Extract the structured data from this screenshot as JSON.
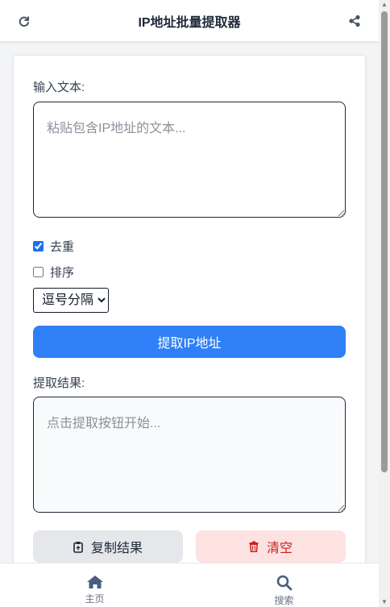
{
  "header": {
    "title": "IP地址批量提取器",
    "left_icon": "refresh-icon",
    "right_icon": "share-icon"
  },
  "form": {
    "input_label": "输入文本:",
    "input_placeholder": "粘贴包含IP地址的文本...",
    "input_value": "",
    "dedupe_label": "去重",
    "dedupe_checked": true,
    "sort_label": "排序",
    "sort_checked": false,
    "separator_selected": "逗号分隔",
    "extract_button": "提取IP地址",
    "result_label": "提取结果:",
    "result_placeholder": "点击提取按钮开始...",
    "copy_button": "复制结果",
    "clear_button": "清空"
  },
  "nav": {
    "home_label": "主页",
    "search_label": "搜索"
  },
  "colors": {
    "primary": "#2f7ff7",
    "danger_text": "#c81e1e",
    "danger_bg": "#fee2e2",
    "neutral_bg": "#e5e7eb"
  }
}
